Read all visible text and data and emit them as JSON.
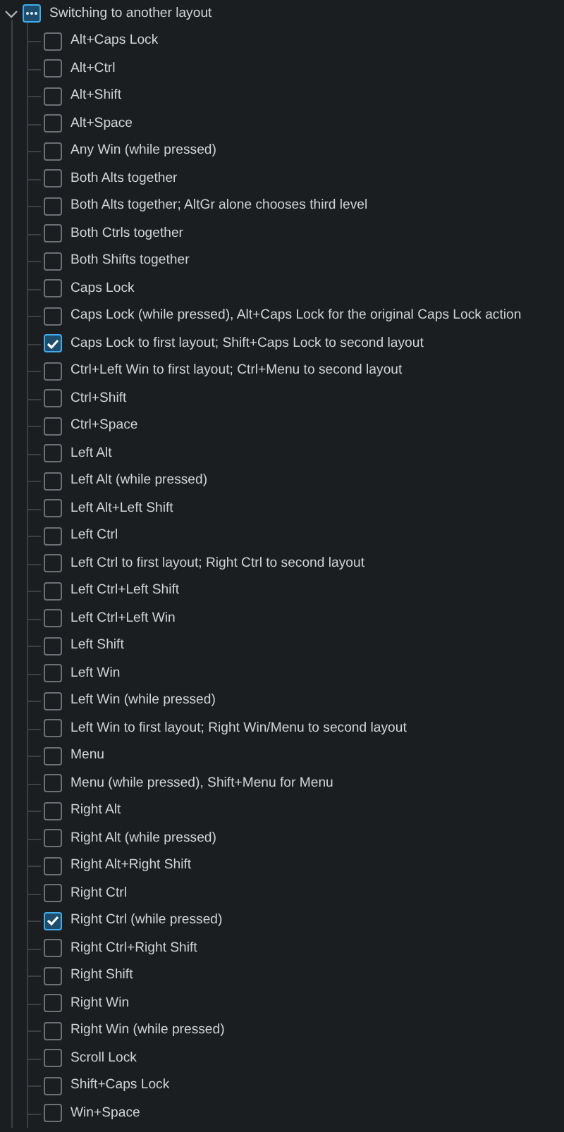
{
  "group": {
    "label": "Switching to another layout",
    "expanded": true,
    "partially_checked": true
  },
  "options": [
    {
      "label": "Alt+Caps Lock",
      "checked": false
    },
    {
      "label": "Alt+Ctrl",
      "checked": false
    },
    {
      "label": "Alt+Shift",
      "checked": false
    },
    {
      "label": "Alt+Space",
      "checked": false
    },
    {
      "label": "Any Win (while pressed)",
      "checked": false
    },
    {
      "label": "Both Alts together",
      "checked": false
    },
    {
      "label": "Both Alts together; AltGr alone chooses third level",
      "checked": false
    },
    {
      "label": "Both Ctrls together",
      "checked": false
    },
    {
      "label": "Both Shifts together",
      "checked": false
    },
    {
      "label": "Caps Lock",
      "checked": false
    },
    {
      "label": "Caps Lock (while pressed), Alt+Caps Lock for the original Caps Lock action",
      "checked": false
    },
    {
      "label": "Caps Lock to first layout; Shift+Caps Lock to second layout",
      "checked": true
    },
    {
      "label": "Ctrl+Left Win to first layout; Ctrl+Menu to second layout",
      "checked": false
    },
    {
      "label": "Ctrl+Shift",
      "checked": false
    },
    {
      "label": "Ctrl+Space",
      "checked": false
    },
    {
      "label": "Left Alt",
      "checked": false
    },
    {
      "label": "Left Alt (while pressed)",
      "checked": false
    },
    {
      "label": "Left Alt+Left Shift",
      "checked": false
    },
    {
      "label": "Left Ctrl",
      "checked": false
    },
    {
      "label": "Left Ctrl to first layout; Right Ctrl to second layout",
      "checked": false
    },
    {
      "label": "Left Ctrl+Left Shift",
      "checked": false
    },
    {
      "label": "Left Ctrl+Left Win",
      "checked": false
    },
    {
      "label": "Left Shift",
      "checked": false
    },
    {
      "label": "Left Win",
      "checked": false
    },
    {
      "label": "Left Win (while pressed)",
      "checked": false
    },
    {
      "label": "Left Win to first layout; Right Win/Menu to second layout",
      "checked": false
    },
    {
      "label": "Menu",
      "checked": false
    },
    {
      "label": "Menu (while pressed), Shift+Menu for Menu",
      "checked": false
    },
    {
      "label": "Right Alt",
      "checked": false
    },
    {
      "label": "Right Alt (while pressed)",
      "checked": false
    },
    {
      "label": "Right Alt+Right Shift",
      "checked": false
    },
    {
      "label": "Right Ctrl",
      "checked": false
    },
    {
      "label": "Right Ctrl (while pressed)",
      "checked": true
    },
    {
      "label": "Right Ctrl+Right Shift",
      "checked": false
    },
    {
      "label": "Right Shift",
      "checked": false
    },
    {
      "label": "Right Win",
      "checked": false
    },
    {
      "label": "Right Win (while pressed)",
      "checked": false
    },
    {
      "label": "Scroll Lock",
      "checked": false
    },
    {
      "label": "Shift+Caps Lock",
      "checked": false
    },
    {
      "label": "Win+Space",
      "checked": false
    }
  ]
}
